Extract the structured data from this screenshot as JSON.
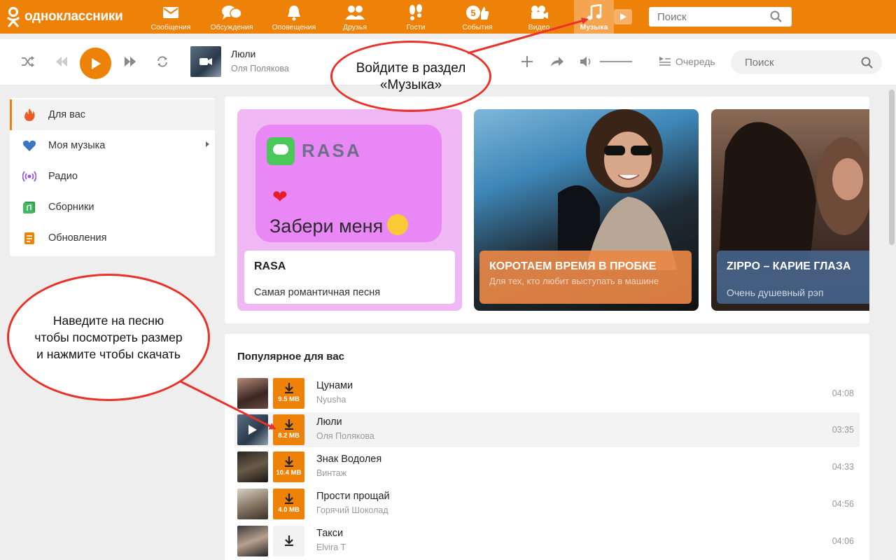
{
  "brand": {
    "name": "одноклассники",
    "accent": "#ee8208",
    "annotation_color": "#e8332a"
  },
  "nav": [
    {
      "id": "messages",
      "label": "Сообщения",
      "icon": "envelope-icon"
    },
    {
      "id": "discussions",
      "label": "Обсуждения",
      "icon": "chat-bubbles-icon"
    },
    {
      "id": "notifications",
      "label": "Оповещения",
      "icon": "bell-icon"
    },
    {
      "id": "friends",
      "label": "Друзья",
      "icon": "friends-icon"
    },
    {
      "id": "guests",
      "label": "Гости",
      "icon": "footprints-icon"
    },
    {
      "id": "events",
      "label": "События",
      "icon": "events-icon"
    },
    {
      "id": "video",
      "label": "Видео",
      "icon": "video-camera-icon"
    },
    {
      "id": "music",
      "label": "Музыка",
      "icon": "music-note-icon",
      "active": true
    }
  ],
  "top_search": {
    "placeholder": "Поиск"
  },
  "player": {
    "now_playing": {
      "title": "Люли",
      "artist": "Оля Полякова"
    },
    "queue_label": "Очередь",
    "search_placeholder": "Поиск"
  },
  "sidebar": [
    {
      "label": "Для вас",
      "icon": "fire-icon",
      "active": true
    },
    {
      "label": "Моя музыка",
      "icon": "heart-icon",
      "has_submenu": true
    },
    {
      "label": "Радио",
      "icon": "radio-icon"
    },
    {
      "label": "Сборники",
      "icon": "collections-icon"
    },
    {
      "label": "Обновления",
      "icon": "updates-icon"
    }
  ],
  "banners": [
    {
      "artwork_brand": "RASA",
      "artwork_song": "Забери меня",
      "title": "RASA",
      "subtitle": "Самая романтичная песня"
    },
    {
      "title": "КОРОТАЕМ ВРЕМЯ В ПРОБКЕ",
      "subtitle": "Для тех, кто любит выступать в машине"
    },
    {
      "title": "ZIPPO – КАРИЕ ГЛАЗА",
      "subtitle": "Очень душевный рэп"
    }
  ],
  "popular": {
    "title": "Популярное для вас",
    "tracks": [
      {
        "title": "Цунами",
        "artist": "Nyusha",
        "size": "9.5 MB",
        "duration": "04:08"
      },
      {
        "title": "Люли",
        "artist": "Оля Полякова",
        "size": "8.2 MB",
        "duration": "03:35",
        "hover": true
      },
      {
        "title": "Знак Водолея",
        "artist": "Винтаж",
        "size": "10.4 MB",
        "duration": "04:33"
      },
      {
        "title": "Прости прощай",
        "artist": "Горячий Шоколад",
        "size": "4.0 MB",
        "duration": "04:56"
      },
      {
        "title": "Такси",
        "artist": "Elvira T",
        "size": "",
        "duration": "04:06"
      }
    ]
  },
  "annotations": {
    "music_hint": [
      "Войдите в раздел",
      "«Музыка»"
    ],
    "download_hint": [
      "Наведите на песню",
      "чтобы посмотреть размер",
      "и нажмите чтобы скачать"
    ]
  }
}
